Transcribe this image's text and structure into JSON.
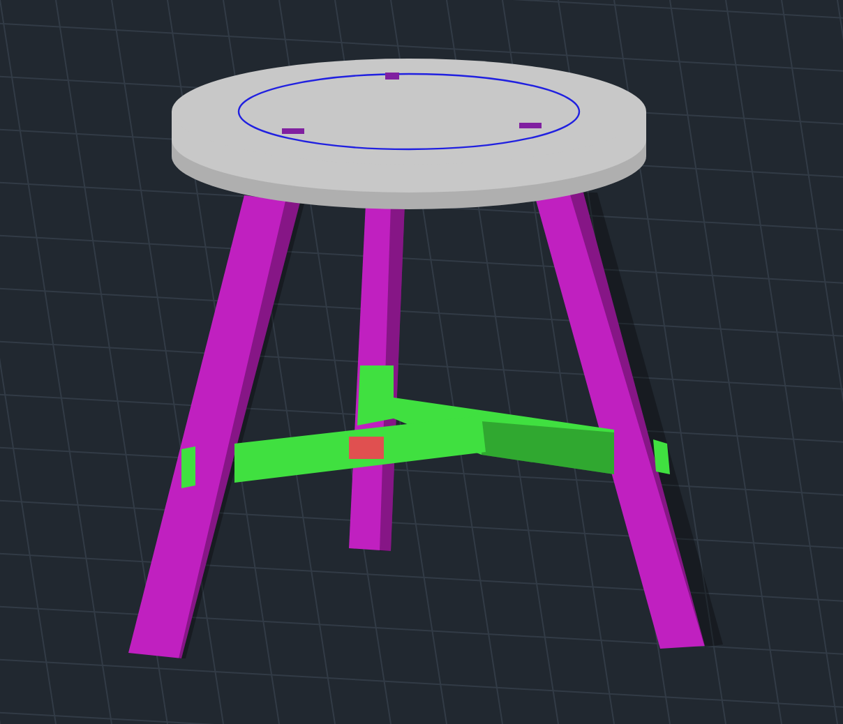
{
  "model": {
    "parts": [
      {
        "kind": "leg",
        "color": "#c020c0"
      },
      {
        "kind": "leg",
        "color": "#c020c0"
      },
      {
        "kind": "leg",
        "color": "#c020c0"
      },
      {
        "kind": "stretcher",
        "color": "#40e040"
      },
      {
        "kind": "seat",
        "color": "#c8c8c8"
      }
    ]
  }
}
